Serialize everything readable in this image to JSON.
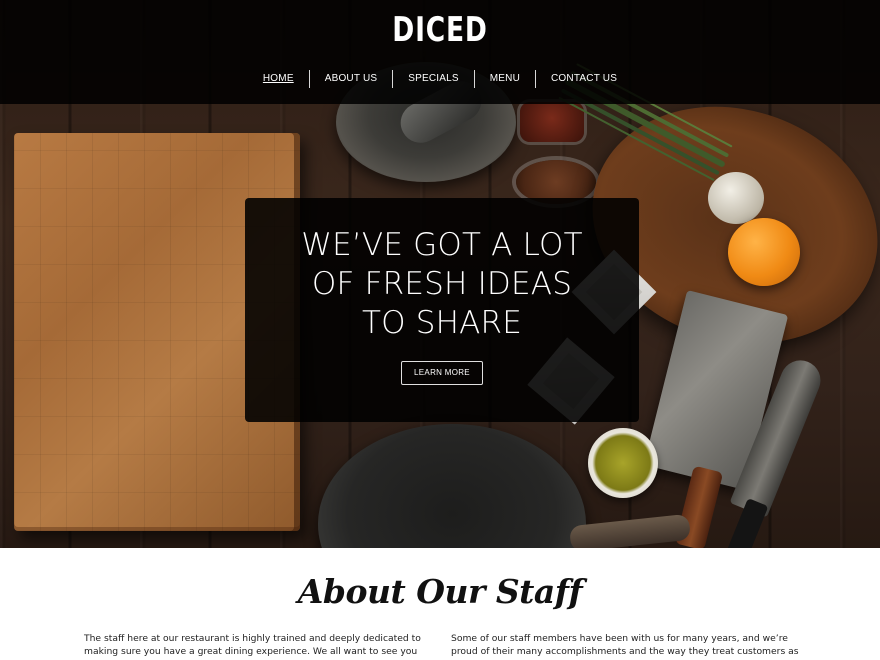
{
  "header": {
    "logo": "DICED",
    "nav": [
      {
        "label": "HOME",
        "active": true
      },
      {
        "label": "ABOUT US",
        "active": false
      },
      {
        "label": "SPECIALS",
        "active": false
      },
      {
        "label": "MENU",
        "active": false
      },
      {
        "label": "CONTACT US",
        "active": false
      }
    ]
  },
  "hero": {
    "heading_lines": [
      "WE’VE GOT A LOT",
      "OF FRESH IDEAS",
      "TO SHARE"
    ],
    "button_label": "LEARN MORE"
  },
  "about": {
    "title": "About Our Staff",
    "left_paragraph": "The staff here at our restaurant is highly trained and deeply dedicated to making sure you have a great dining experience. We all want to see you happy and smiling,",
    "right_paragraph": "Some of our staff members have been with us for many years, and we’re proud of their many accomplishments and the way they treat customers as valued members"
  },
  "colors": {
    "header_bg": "#000000",
    "text_light": "#ffffff",
    "text_dark": "#222222",
    "page_bg": "#ffffff"
  }
}
